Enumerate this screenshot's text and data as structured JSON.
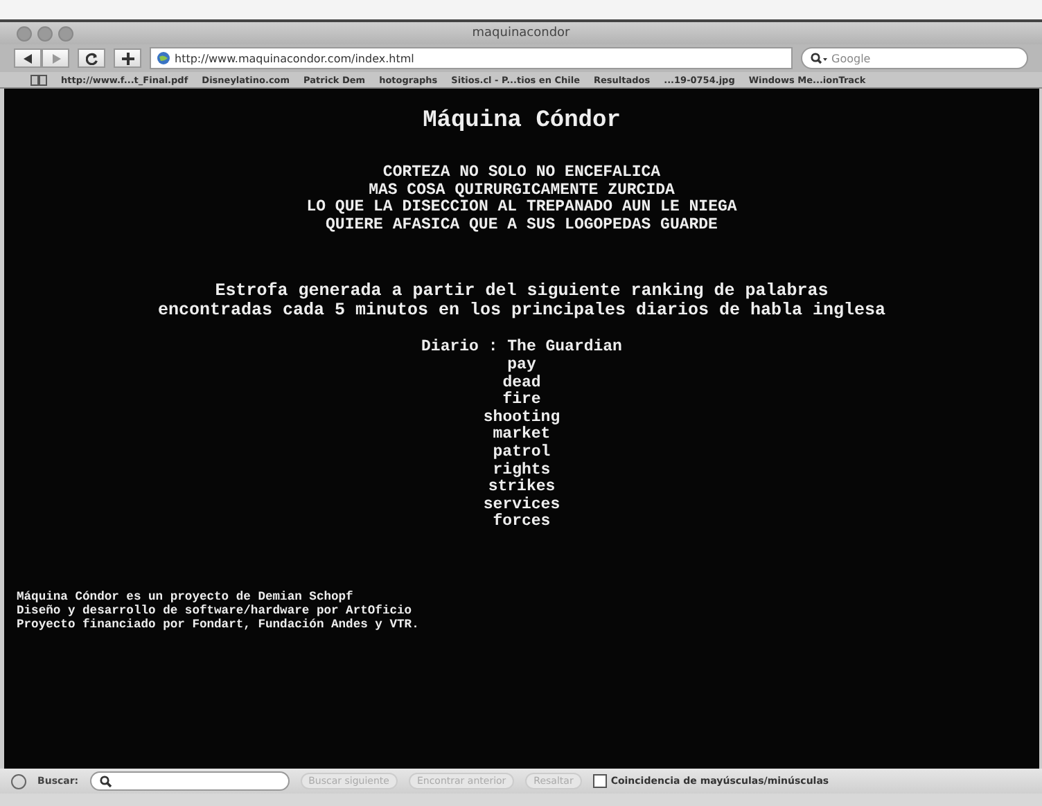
{
  "window": {
    "title": "maquinacondor"
  },
  "toolbar": {
    "url": "http://www.maquinacondor.com/index.html",
    "search": {
      "placeholder": "Google"
    }
  },
  "bookmarks": [
    "http://www.f...t_Final.pdf",
    "Disneylatino.com",
    "Patrick Dem",
    "hotographs",
    "Sitios.cl - P...tios en Chile",
    "Resultados",
    "...19-0754.jpg",
    "Windows Me...ionTrack"
  ],
  "page": {
    "title": "Máquina Cóndor",
    "poem": [
      "CORTEZA NO SOLO NO ENCEFALICA",
      "MAS COSA QUIRURGICAMENTE ZURCIDA",
      "LO QUE LA DISECCION AL TREPANADO AUN LE NIEGA",
      "QUIERE AFASICA QUE A SUS LOGOPEDAS GUARDE"
    ],
    "intro": [
      "Estrofa generada a partir del siguiente ranking de palabras",
      "encontradas cada 5 minutos en los principales diarios de habla inglesa"
    ],
    "source": "Diario : The Guardian",
    "words": [
      "pay",
      "dead",
      "fire",
      "shooting",
      "market",
      "patrol",
      "rights",
      "strikes",
      "services",
      "forces"
    ],
    "credits": [
      "Máquina Cóndor es un proyecto de Demian Schopf",
      "Diseño y desarrollo de software/hardware por ArtOficio",
      "Proyecto financiado por Fondart, Fundación Andes y VTR."
    ]
  },
  "find_bar": {
    "label": "Buscar:",
    "buttons": [
      {
        "label": "Buscar siguiente",
        "disabled": true
      },
      {
        "label": "Encontrar anterior",
        "disabled": true
      },
      {
        "label": "Resaltar",
        "disabled": true
      }
    ],
    "match_case": {
      "label": "Coincidencia de mayúsculas/minúsculas",
      "checked": false
    }
  }
}
